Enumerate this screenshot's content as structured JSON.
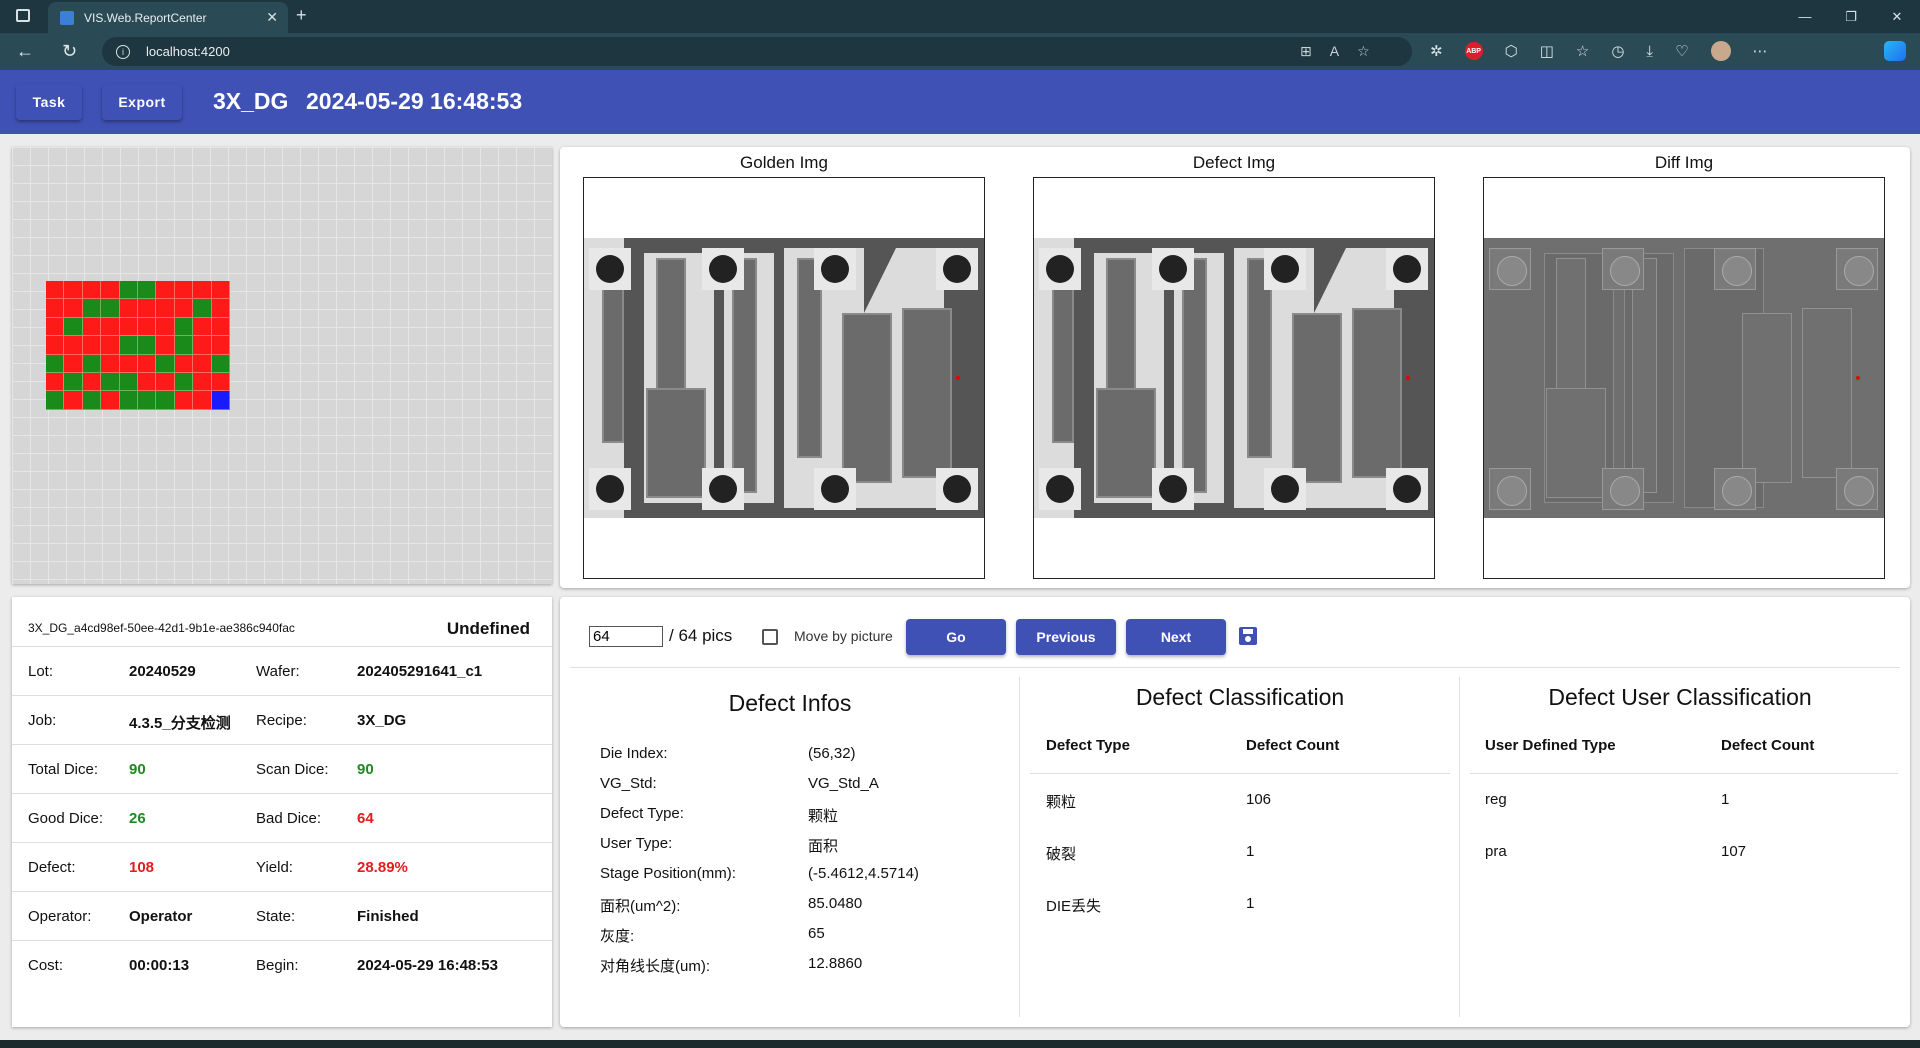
{
  "browser": {
    "tab_title": "VIS.Web.ReportCenter",
    "url": "localhost:4200",
    "abp_label": "ABP"
  },
  "header": {
    "task_label": "Task",
    "export_label": "Export",
    "recipe": "3X_DG",
    "datetime": "2024-05-29 16:48:53"
  },
  "wafer_map": {
    "rows": [
      [
        "red",
        "red",
        "red",
        "red",
        "green",
        "green",
        "red",
        "red",
        "red",
        "red"
      ],
      [
        "red",
        "red",
        "green",
        "green",
        "red",
        "red",
        "red",
        "red",
        "green",
        "red"
      ],
      [
        "red",
        "green",
        "red",
        "red",
        "red",
        "red",
        "red",
        "green",
        "red",
        "red"
      ],
      [
        "red",
        "red",
        "red",
        "red",
        "green",
        "green",
        "red",
        "green",
        "red",
        "red"
      ],
      [
        "green",
        "red",
        "green",
        "red",
        "red",
        "red",
        "green",
        "red",
        "red",
        "green"
      ],
      [
        "red",
        "green",
        "red",
        "green",
        "green",
        "red",
        "red",
        "green",
        "red",
        "red"
      ],
      [
        "green",
        "red",
        "green",
        "red",
        "green",
        "green",
        "green",
        "red",
        "red",
        "blue"
      ]
    ],
    "colors": {
      "red": "#ff1a1a",
      "green": "#1a8a1a",
      "blue": "#1a1aff"
    }
  },
  "images": {
    "golden_title": "Golden Img",
    "defect_title": "Defect Img",
    "diff_title": "Diff Img"
  },
  "info": {
    "id": "3X_DG_a4cd98ef-50ee-42d1-9b1e-ae386c940fac",
    "status": "Undefined",
    "rows": [
      {
        "l1": "Lot:",
        "v1": "20240529",
        "l2": "Wafer:",
        "v2": "202405291641_c1"
      },
      {
        "l1": "Job:",
        "v1": "4.3.5_分支检测",
        "l2": "Recipe:",
        "v2": "3X_DG"
      },
      {
        "l1": "Total Dice:",
        "v1": "90",
        "l2": "Scan Dice:",
        "v2": "90"
      },
      {
        "l1": "Good Dice:",
        "v1": "26",
        "l2": "Bad Dice:",
        "v2": "64"
      },
      {
        "l1": "Defect:",
        "v1": "108",
        "l2": "Yield:",
        "v2": "28.89%"
      },
      {
        "l1": "Operator:",
        "v1": "Operator",
        "l2": "State:",
        "v2": "Finished"
      },
      {
        "l1": "Cost:",
        "v1": "00:00:13",
        "l2": "Begin:",
        "v2": "2024-05-29 16:48:53"
      }
    ]
  },
  "toolbar": {
    "page_value": "64",
    "page_total": "/ 64 pics",
    "move_label": "Move by picture",
    "go_label": "Go",
    "prev_label": "Previous",
    "next_label": "Next"
  },
  "defect_infos": {
    "title": "Defect Infos",
    "rows": [
      {
        "k": "Die Index:",
        "v": "(56,32)"
      },
      {
        "k": "VG_Std:",
        "v": "VG_Std_A"
      },
      {
        "k": "Defect Type:",
        "v": "颗粒"
      },
      {
        "k": "User Type:",
        "v": "面积"
      },
      {
        "k": "Stage Position(mm):",
        "v": "(-5.4612,4.5714)"
      },
      {
        "k": "面积(um^2):",
        "v": "85.0480"
      },
      {
        "k": "灰度:",
        "v": "65"
      },
      {
        "k": "对角线长度(um):",
        "v": "12.8860"
      }
    ]
  },
  "defect_classification": {
    "title": "Defect Classification",
    "col1": "Defect Type",
    "col2": "Defect Count",
    "rows": [
      {
        "type": "颗粒",
        "count": "106"
      },
      {
        "type": "破裂",
        "count": "1"
      },
      {
        "type": "DIE丢失",
        "count": "1"
      }
    ]
  },
  "user_classification": {
    "title": "Defect User Classification",
    "col1": "User Defined Type",
    "col2": "Defect Count",
    "rows": [
      {
        "type": "reg",
        "count": "1"
      },
      {
        "type": "pra",
        "count": "107"
      }
    ]
  }
}
